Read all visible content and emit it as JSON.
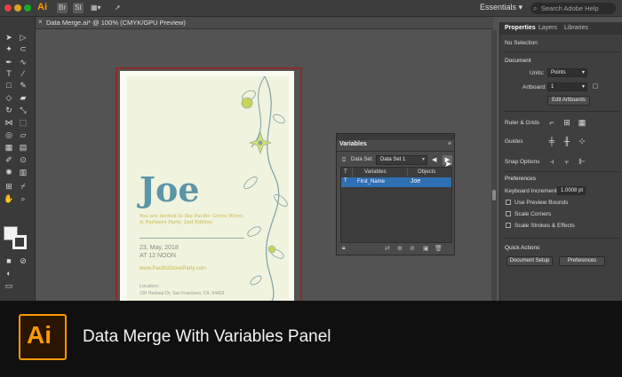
{
  "app": {
    "logo": "Ai",
    "workspace": "Essentials",
    "search_placeholder": "Search Adobe Help",
    "topbar_icons": [
      "Br",
      "St"
    ]
  },
  "document_tab": {
    "close": "×",
    "title": "Data Merge.ai* @ 100% (CMYK/GPU Preview)"
  },
  "artboard": {
    "name": "Joe",
    "invite_text": "You are invited to the Pacific Grove Wives & Partners Party, 2nd Edition",
    "date": "23, May, 2018",
    "time": "AT 12 NOON",
    "url": "www.PacificGroveParty.com",
    "location_label": "Location:",
    "location_address": "100 Harbour Dr, San Francisco, CA, 94403"
  },
  "variables_panel": {
    "title": "Variables",
    "menu_icon": "≡",
    "dataset_label": "Data Set:",
    "dataset_value": "Data Set 1",
    "columns": [
      "T",
      "Variables",
      "Objects"
    ],
    "rows": [
      {
        "type": "T",
        "variable": "First_Name",
        "object": "Joe"
      }
    ]
  },
  "properties_panel": {
    "tabs": [
      "Properties",
      "Layers",
      "Libraries"
    ],
    "selection": "No Selection",
    "document_header": "Document",
    "units_label": "Units:",
    "units_value": "Points",
    "artboard_label": "Artboard:",
    "artboard_value": "1",
    "edit_artboards_button": "Edit Artboards",
    "ruler_grids_label": "Ruler & Grids",
    "guides_label": "Guides",
    "snap_options_label": "Snap Options",
    "preferences_header": "Preferences",
    "keyboard_increment_label": "Keyboard Increment:",
    "keyboard_increment_value": "1.0008 pt",
    "checkboxes": [
      "Use Preview Bounds",
      "Scale Corners",
      "Scale Strokes & Effects"
    ],
    "quick_actions_header": "Quick Actions",
    "document_setup_button": "Document Setup",
    "preferences_button": "Preferences"
  },
  "banner": {
    "logo": "Ai",
    "title": "Data Merge With Variables Panel"
  },
  "colors": {
    "accent_orange": "#ff9a00",
    "selection_blue": "#2f6fb3",
    "joe_blue": "#5b95a8",
    "invite_gold": "#c9b84a"
  }
}
